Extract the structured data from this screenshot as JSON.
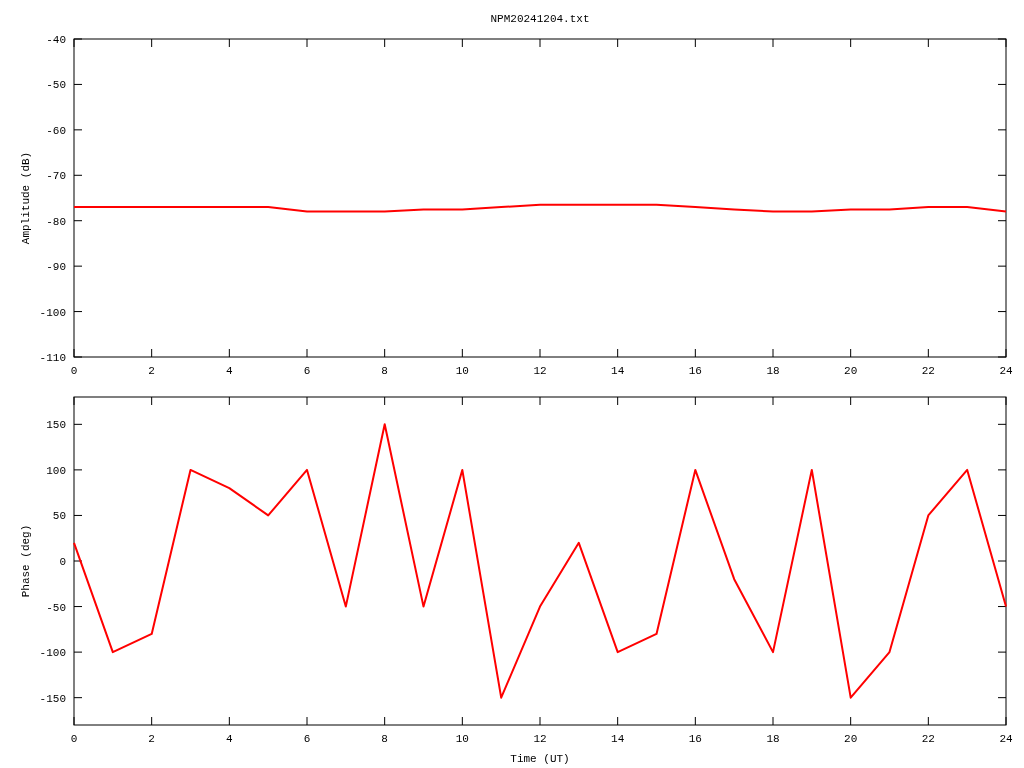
{
  "plots": [
    {
      "chart_data": {
        "type": "line",
        "title": "NPM20241204.txt",
        "ylabel": "Amplitude (dB)",
        "xlim": [
          0,
          24
        ],
        "ylim": [
          -110,
          -40
        ],
        "xticks": [
          0,
          2,
          4,
          6,
          8,
          10,
          12,
          14,
          16,
          18,
          20,
          22,
          24
        ],
        "yticks": [
          -110,
          -100,
          -90,
          -80,
          -70,
          -60,
          -50,
          -40
        ],
        "x": [
          0,
          1,
          2,
          3,
          4,
          5,
          6,
          7,
          8,
          9,
          10,
          11,
          12,
          13,
          14,
          15,
          16,
          17,
          18,
          19,
          20,
          21,
          22,
          23,
          24
        ],
        "series": [
          {
            "color": "#ff0000",
            "values": [
              -77,
              -77,
              -77,
              -77,
              -77,
              -77,
              -78,
              -78,
              -78,
              -77.5,
              -77.5,
              -77,
              -76.5,
              -76.5,
              -76.5,
              -76.5,
              -77,
              -77.5,
              -78,
              -78,
              -77.5,
              -77.5,
              -77,
              -77,
              -78
            ]
          }
        ]
      }
    },
    {
      "chart_data": {
        "type": "line",
        "xlabel": "Time (UT)",
        "ylabel": "Phase (deg)",
        "xlim": [
          0,
          24
        ],
        "ylim": [
          -180,
          180
        ],
        "xticks": [
          0,
          2,
          4,
          6,
          8,
          10,
          12,
          14,
          16,
          18,
          20,
          22,
          24
        ],
        "yticks": [
          -150,
          -100,
          -50,
          0,
          50,
          100,
          150
        ],
        "x": [
          0,
          1,
          2,
          3,
          4,
          5,
          6,
          7,
          8,
          9,
          10,
          11,
          12,
          13,
          14,
          15,
          16,
          17,
          18,
          19,
          20,
          21,
          22,
          23,
          24
        ],
        "series": [
          {
            "color": "#ff0000",
            "values": [
              20,
              -100,
              -80,
              100,
              80,
              50,
              100,
              -50,
              150,
              -50,
              100,
              -150,
              -50,
              20,
              -100,
              -80,
              100,
              -20,
              -100,
              100,
              -150,
              -100,
              50,
              100,
              -50
            ]
          }
        ]
      }
    }
  ]
}
